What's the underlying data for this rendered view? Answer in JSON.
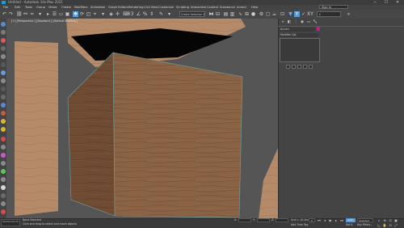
{
  "title": {
    "text": "Untitled - Autodesk 3ds Max 2021",
    "minimize": "─",
    "maximize": "☐",
    "close": "✕"
  },
  "menu": [
    "File",
    "Edit",
    "Tools",
    "Group",
    "Views",
    "Create",
    "Modifiers",
    "Animation",
    "Graph Editors",
    "Rendering",
    "Civil View",
    "Customize",
    "Scripting",
    "Interactive",
    "Content",
    "Substance",
    "Arnold",
    "Help"
  ],
  "workspace_field": "Sign In",
  "selection_set_placeholder": "Create Selection Se",
  "viewport": {
    "label": "[+] [Perspective ] [Standard ] [Default Shading ]"
  },
  "panel": {
    "object_name": "Box001",
    "modifier_list": "Modifier List",
    "color_accent": "#c41e8c"
  },
  "status": {
    "maxscript": "MAXScript Mi",
    "line1": "None Selected",
    "line2": "Click and drag to select and move objects",
    "x_label": "X:",
    "y_label": "Y:",
    "z_label": "Z:",
    "grid": "Grid = 10.0m",
    "add_time_tag": "Add Time Tag",
    "frame": "0",
    "auto": "Auto",
    "set_key": "Set K.",
    "selected": "Selected",
    "key_filters": "Key Filters..."
  },
  "colors": {
    "viewport_bg": "#555556",
    "wood": "#8a6244",
    "selection_highlight": "#5b9bd5"
  }
}
